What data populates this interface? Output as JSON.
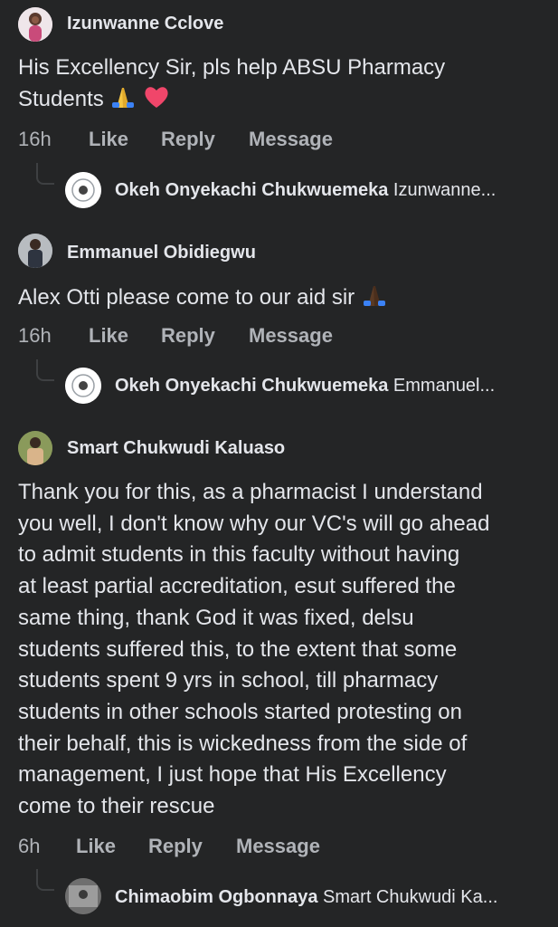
{
  "comments": [
    {
      "author": "Izunwanne Cclove",
      "text_line1": "His Excellency Sir, pls help ABSU Pharmacy",
      "text_line2": "Students",
      "emoji": [
        "folded-hands",
        "red-heart"
      ],
      "time": "16h",
      "like": "Like",
      "reply": "Reply",
      "message": "Message",
      "reply_preview": {
        "author": "Okeh Onyekachi Chukwuemeka",
        "snippet": "Izunwanne..."
      }
    },
    {
      "author": "Emmanuel Obidiegwu",
      "text": "Alex Otti please come to our aid sir",
      "emoji": [
        "folded-hands"
      ],
      "time": "16h",
      "like": "Like",
      "reply": "Reply",
      "message": "Message",
      "reply_preview": {
        "author": "Okeh Onyekachi Chukwuemeka",
        "snippet": "Emmanuel..."
      }
    },
    {
      "author": "Smart Chukwudi Kaluaso",
      "lines": [
        "Thank you for this, as a pharmacist I understand",
        "you well, I don't know why our VC's will go ahead",
        "to admit students in this faculty without having",
        "at least partial accreditation, esut suffered the",
        "same thing, thank God it was fixed, delsu",
        "students suffered this, to the extent that some",
        "students spent 9 yrs in school, till pharmacy",
        "students in other schools started protesting on",
        "their behalf, this is wickedness from the side of",
        "management, I just hope that His Excellency",
        "come to their rescue"
      ],
      "time": "6h",
      "like": "Like",
      "reply": "Reply",
      "message": "Message",
      "reply_preview": {
        "author": "Chimaobim Ogbonnaya",
        "snippet": "Smart Chukwudi Ka..."
      }
    }
  ],
  "colors": {
    "background": "#242526",
    "text": "#e4e6eb",
    "meta": "#b0b3b8",
    "thread_line": "#3e4042"
  }
}
